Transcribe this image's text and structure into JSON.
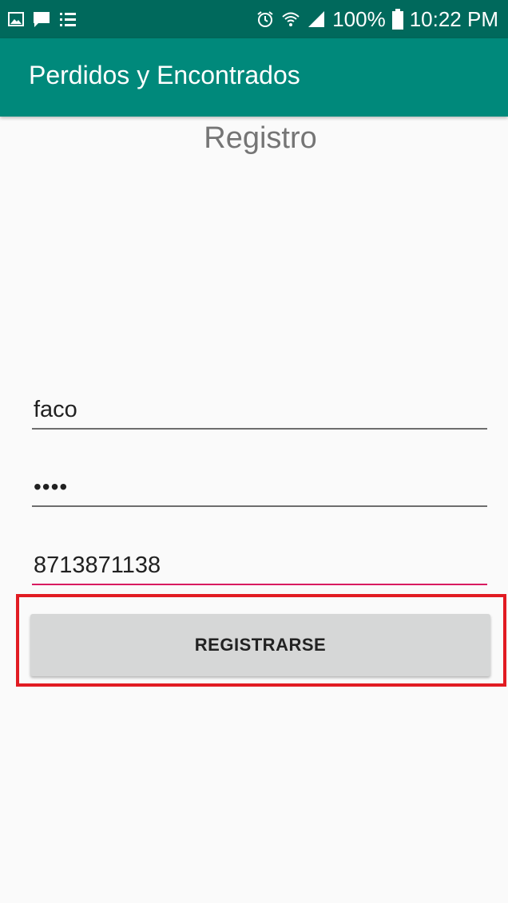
{
  "status_bar": {
    "left_icons": [
      "image-notification-icon",
      "chat-notification-icon",
      "list-notification-icon"
    ],
    "right_icons": [
      "alarm-icon",
      "wifi-icon",
      "signal-icon",
      "battery-icon"
    ],
    "battery": "100%",
    "time": "10:22 PM",
    "background": "#00695c"
  },
  "app_bar": {
    "title": "Perdidos y Encontrados",
    "background": "#00897b"
  },
  "screen": {
    "heading": "Registro"
  },
  "form": {
    "username": "faco",
    "password_mask": "••••",
    "phone": "8713871138",
    "register_label": "REGISTRARSE"
  },
  "colors": {
    "focus_underline": "#d81b60",
    "highlight_box": "#e11b22",
    "button_bg": "#d6d7d7"
  }
}
